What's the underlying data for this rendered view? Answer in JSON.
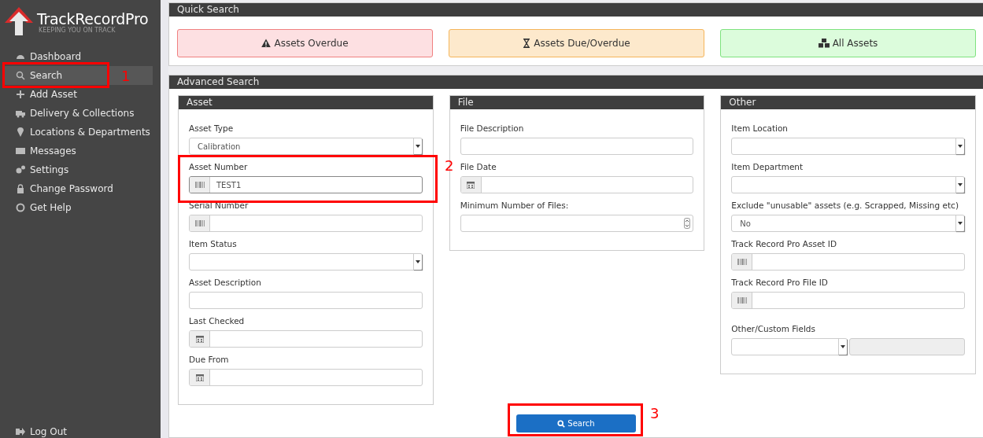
{
  "brand": {
    "name": "TrackRecord",
    "suffix": "Pro",
    "tagline": "KEEPING YOU ON TRACK"
  },
  "sidebar": {
    "items": [
      {
        "label": "Dashboard",
        "selected": false
      },
      {
        "label": "Search",
        "selected": true
      },
      {
        "label": "Add Asset",
        "selected": false
      },
      {
        "label": "Delivery & Collections",
        "selected": false
      },
      {
        "label": "Locations & Departments",
        "selected": false
      },
      {
        "label": "Messages",
        "selected": false
      },
      {
        "label": "Settings",
        "selected": false
      },
      {
        "label": "Change Password",
        "selected": false
      },
      {
        "label": "Get Help",
        "selected": false
      }
    ],
    "footer": "Log Out"
  },
  "quick_search": {
    "title": "Quick Search",
    "buttons": [
      {
        "label": "Assets Overdue",
        "kind": "overdue"
      },
      {
        "label": "Assets Due/Overdue",
        "kind": "due"
      },
      {
        "label": "All Assets",
        "kind": "all"
      }
    ]
  },
  "advanced_search": {
    "title": "Advanced Search",
    "sections": [
      {
        "title": "Asset",
        "fields": [
          {
            "label": "Asset Type",
            "kind": "select",
            "value": "Calibration"
          },
          {
            "label": "Asset Number",
            "kind": "barcode",
            "value": "TEST1"
          },
          {
            "label": "Serial Number",
            "kind": "barcode"
          },
          {
            "label": "Item Status",
            "kind": "select"
          },
          {
            "label": "Asset Description",
            "kind": "text"
          },
          {
            "label": "Last Checked",
            "kind": "date"
          },
          {
            "label": "Due From",
            "kind": "date"
          }
        ]
      },
      {
        "title": "File",
        "fields": [
          {
            "label": "File Description",
            "kind": "text"
          },
          {
            "label": "File Date",
            "kind": "date"
          },
          {
            "label": "Minimum Number of Files:",
            "kind": "number"
          }
        ]
      },
      {
        "title": "Other",
        "fields": [
          {
            "label": "Item Location",
            "kind": "select"
          },
          {
            "label": "Item Department",
            "kind": "select"
          },
          {
            "label": "Exclude \"unusable\" assets (e.g. Scrapped, Missing etc)",
            "kind": "select",
            "value": "No"
          },
          {
            "label": "Track Record Pro Asset ID",
            "kind": "barcode"
          },
          {
            "label": "Track Record Pro File ID",
            "kind": "barcode"
          },
          {
            "label": "Other/Custom Fields",
            "kind": "custom"
          }
        ]
      }
    ],
    "search_button": "Search"
  },
  "annotations": [
    {
      "label": "1"
    },
    {
      "label": "2"
    },
    {
      "label": "3"
    }
  ]
}
